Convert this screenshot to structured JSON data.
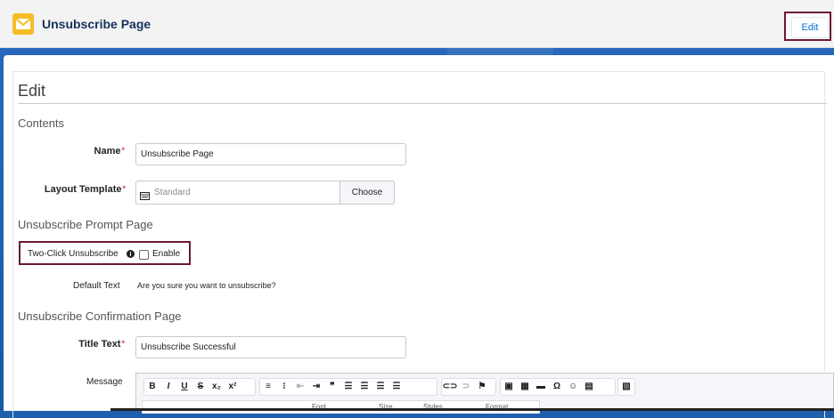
{
  "header": {
    "title": "Unsubscribe Page",
    "edit_button": "Edit",
    "icon": "envelope-icon"
  },
  "form": {
    "heading": "Edit",
    "sections": {
      "contents": "Contents",
      "prompt": "Unsubscribe Prompt Page",
      "confirmation": "Unsubscribe Confirmation Page"
    },
    "name": {
      "label": "Name",
      "required_mark": "*",
      "value": "Unsubscribe Page"
    },
    "layout_template": {
      "label": "Layout Template",
      "required_mark": "*",
      "placeholder": "Standard",
      "button": "Choose"
    },
    "two_click": {
      "label": "Two-Click Unsubscribe",
      "checkbox_label": "Enable",
      "checked": false
    },
    "default_text": {
      "label": "Default Text",
      "value": "Are you sure you want to unsubscribe?"
    },
    "title_text": {
      "label": "Title Text",
      "required_mark": "*",
      "value": "Unsubscribe Successful"
    },
    "message": {
      "label": "Message"
    }
  },
  "toolbar": {
    "bold": "B",
    "italic": "I",
    "underline": "U",
    "strike": "S",
    "subscript": "x₂",
    "superscript": "x²",
    "quote": "❞",
    "omega": "Ω",
    "font": "Font",
    "size": "Size",
    "styles": "Styles",
    "format": "Format"
  },
  "colors": {
    "accent": "#0070d2",
    "highlight_border": "#6b1832",
    "icon_yellow": "#f4bc25"
  }
}
